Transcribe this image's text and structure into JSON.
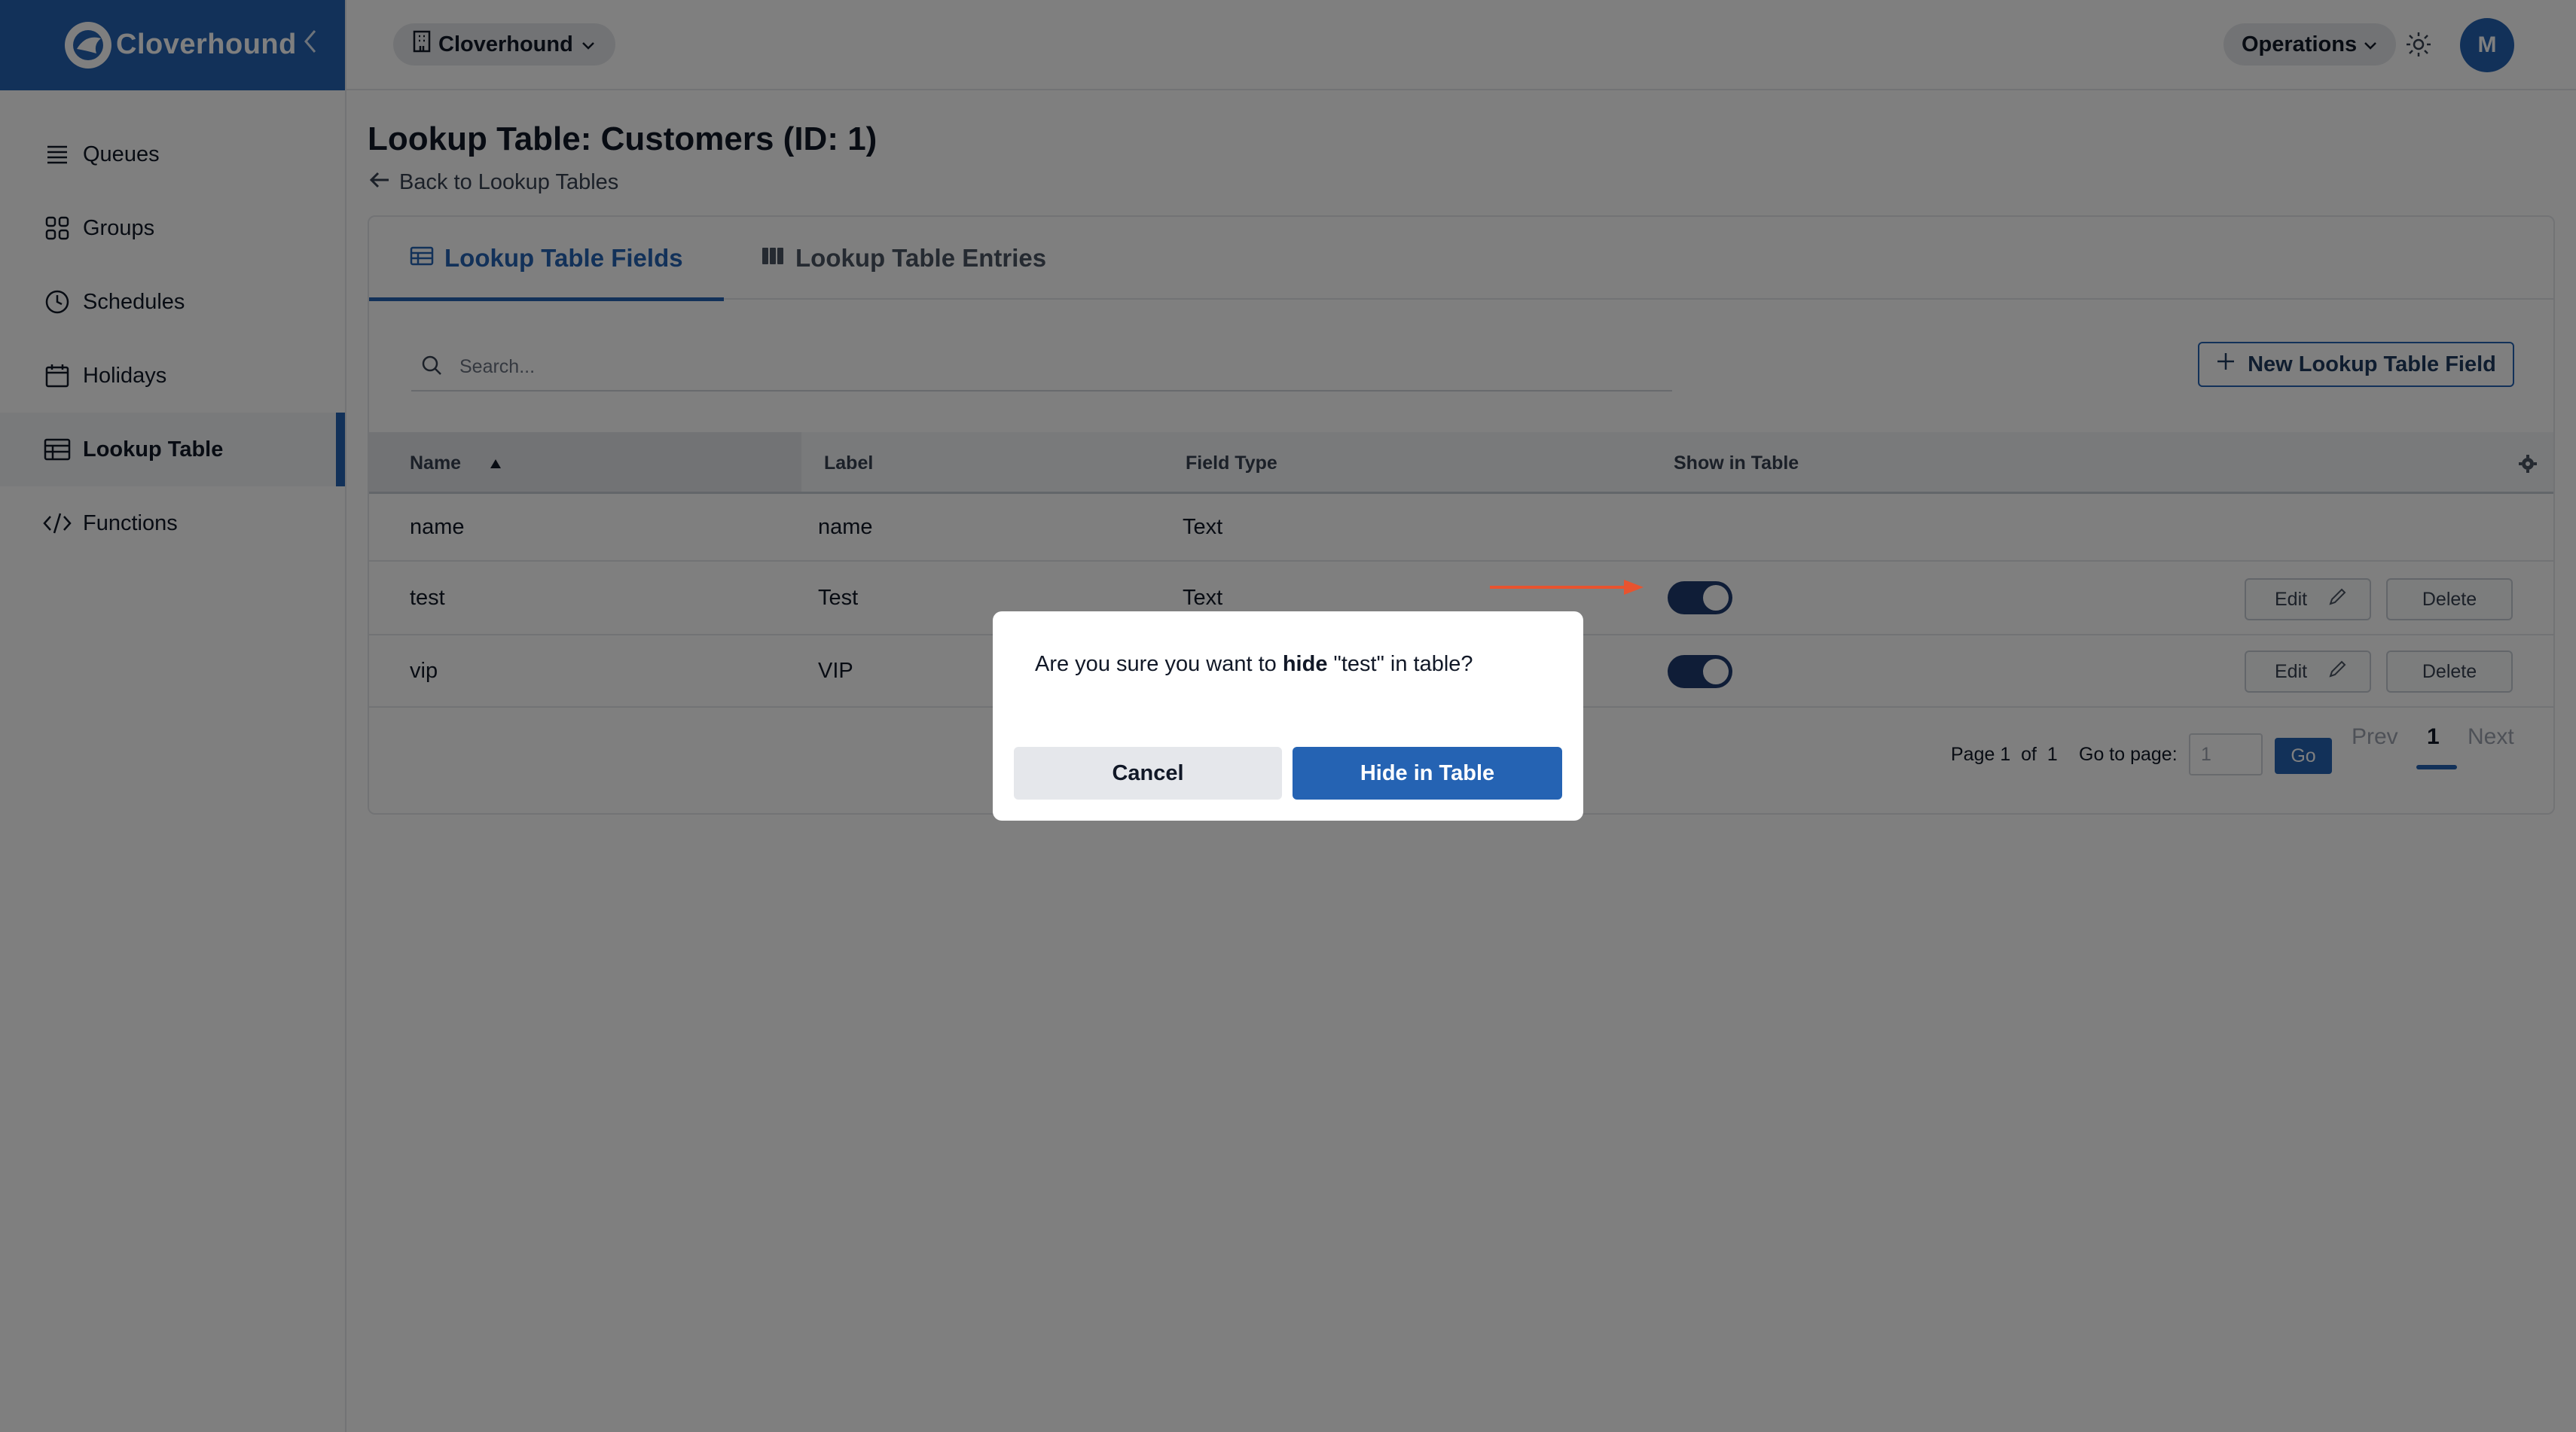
{
  "brand": {
    "name": "Cloverhound"
  },
  "sidebar": {
    "items": [
      {
        "label": "Queues",
        "icon": "list-icon"
      },
      {
        "label": "Groups",
        "icon": "grid-icon"
      },
      {
        "label": "Schedules",
        "icon": "clock-icon"
      },
      {
        "label": "Holidays",
        "icon": "calendar-icon"
      },
      {
        "label": "Lookup Table",
        "icon": "table-icon",
        "active": true
      },
      {
        "label": "Functions",
        "icon": "code-icon"
      }
    ]
  },
  "topbar": {
    "org": "Cloverhound",
    "workspace": "Operations",
    "avatar_initial": "M"
  },
  "page": {
    "title": "Lookup Table: Customers (ID: 1)",
    "back_link": "Back to Lookup Tables"
  },
  "tabs": [
    {
      "label": "Lookup Table Fields",
      "active": true
    },
    {
      "label": "Lookup Table Entries",
      "active": false
    }
  ],
  "search": {
    "placeholder": "Search..."
  },
  "new_button": "New Lookup Table Field",
  "table": {
    "headers": [
      "Name",
      "Label",
      "Field Type",
      "Show in Table"
    ],
    "rows": [
      {
        "name": "name",
        "label": "name",
        "type": "Text",
        "show": null
      },
      {
        "name": "test",
        "label": "Test",
        "type": "Text",
        "show": true
      },
      {
        "name": "vip",
        "label": "VIP",
        "type": "",
        "show": true
      }
    ],
    "edit_label": "Edit",
    "delete_label": "Delete"
  },
  "pagination": {
    "page_label": "Page",
    "current": "1",
    "of_label": "of",
    "total": "1",
    "goto_label": "Go to page:",
    "goto_value": "1",
    "go_label": "Go",
    "prev_label": "Prev",
    "next_label": "Next"
  },
  "modal": {
    "text_before": "Are you sure you want to ",
    "text_bold": "hide",
    "text_after": " \"test\" in table?",
    "cancel_label": "Cancel",
    "confirm_label": "Hide in Table"
  },
  "colors": {
    "primary": "#2563b3",
    "toggle": "#1e3a6e",
    "annotation_arrow": "#e8532f"
  }
}
